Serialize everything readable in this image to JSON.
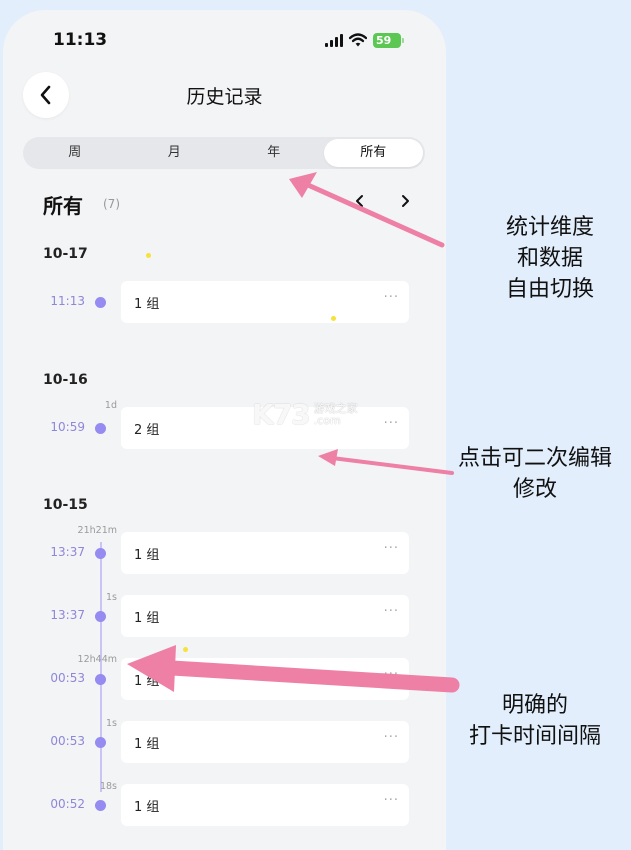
{
  "status_bar": {
    "time": "11:13",
    "battery": "59"
  },
  "header": {
    "title": "历史记录"
  },
  "segments": [
    {
      "label": "周",
      "active": false
    },
    {
      "label": "月",
      "active": false
    },
    {
      "label": "年",
      "active": false
    },
    {
      "label": "所有",
      "active": true
    }
  ],
  "section": {
    "title": "所有",
    "count": "(7)"
  },
  "groups": [
    {
      "date": "10-17",
      "entries": [
        {
          "gap": "",
          "time": "11:13",
          "label": "1 组"
        }
      ]
    },
    {
      "date": "10-16",
      "entries": [
        {
          "gap": "1d",
          "time": "10:59",
          "label": "2 组"
        }
      ]
    },
    {
      "date": "10-15",
      "entries": [
        {
          "gap": "21h21m",
          "time": "13:37",
          "label": "1 组"
        },
        {
          "gap": "1s",
          "time": "13:37",
          "label": "1 组"
        },
        {
          "gap": "12h44m",
          "time": "00:53",
          "label": "1 组"
        },
        {
          "gap": "1s",
          "time": "00:53",
          "label": "1 组"
        },
        {
          "gap": "18s",
          "time": "00:52",
          "label": "1 组"
        }
      ]
    }
  ],
  "more_glyph": "···",
  "annotations": {
    "top": [
      "统计维度",
      "和数据",
      "自由切换"
    ],
    "middle": [
      "点击可二次编辑",
      "修改"
    ],
    "bottom": [
      "明确的",
      "打卡时间间隔"
    ]
  },
  "watermark": {
    "big": "K73",
    "line1": "游戏之家",
    "line2": ".com"
  },
  "colors": {
    "accent": "#958bf0",
    "arrow": "#ee7fa5",
    "battery": "#5cc853",
    "background": "#e2eefb"
  }
}
